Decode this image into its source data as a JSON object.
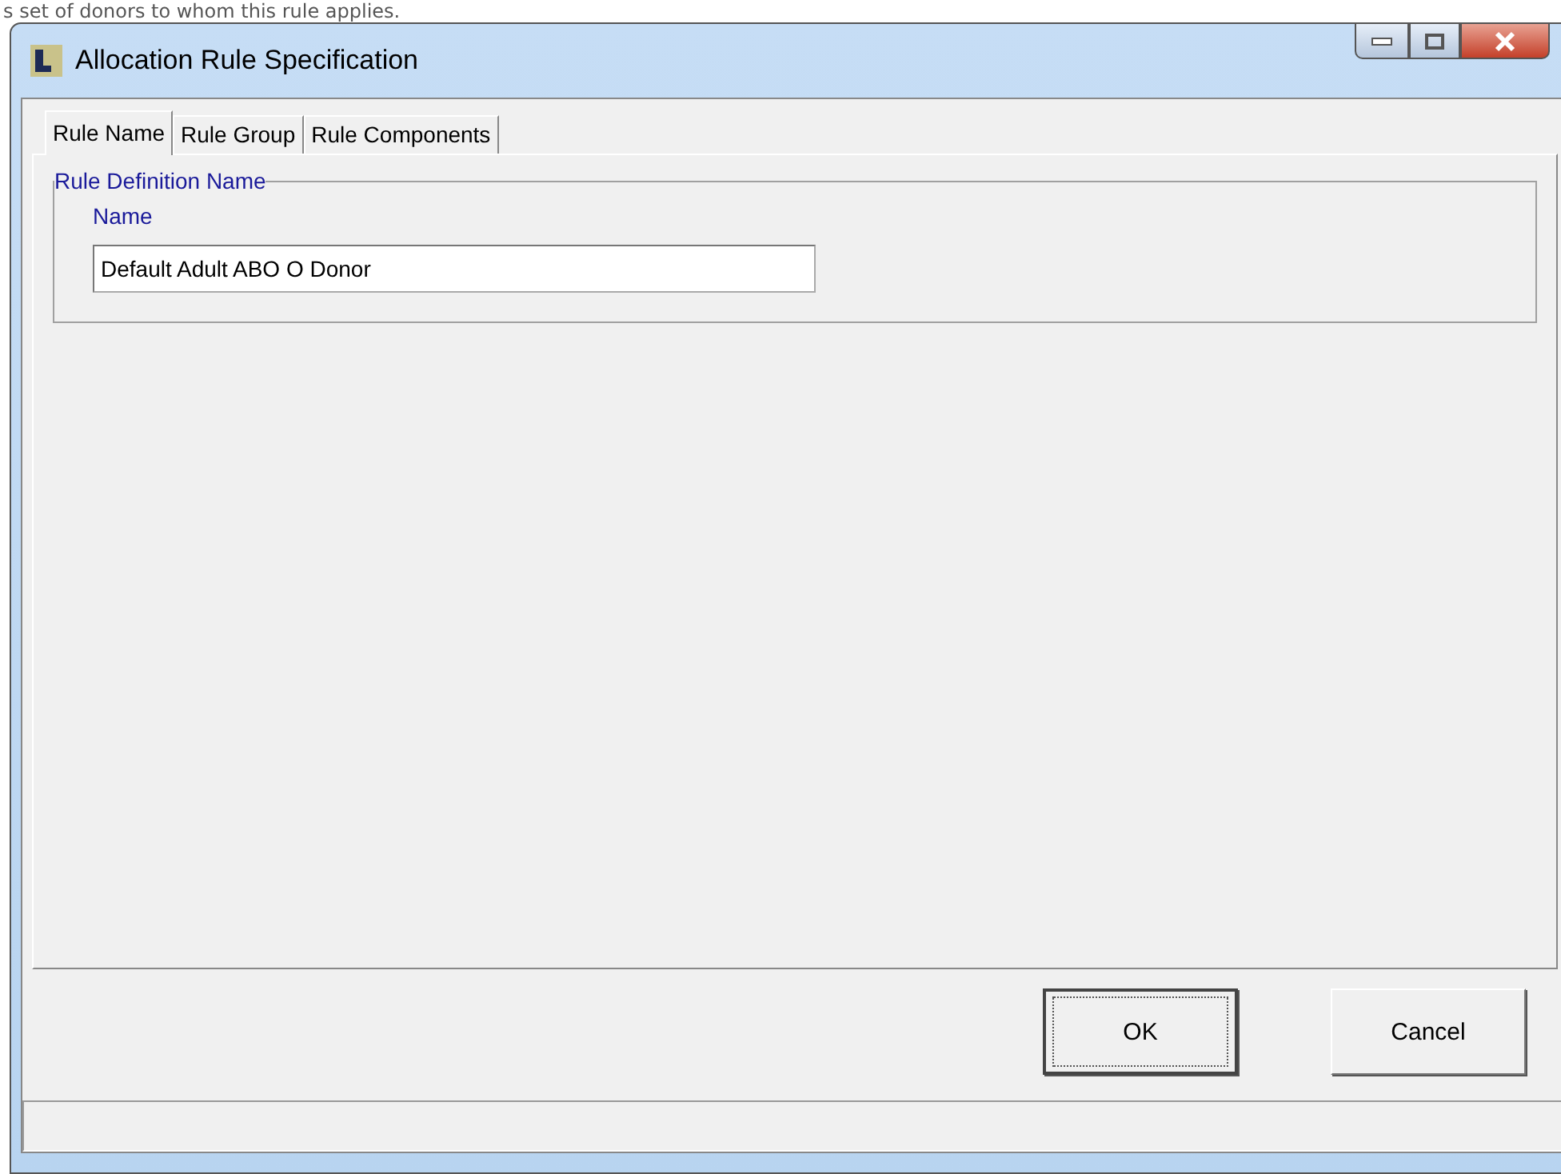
{
  "background_text": "s set of donors to whom this rule applies.",
  "window": {
    "title": "Allocation Rule Specification"
  },
  "tabs": [
    {
      "label": "Rule Name",
      "selected": true
    },
    {
      "label": "Rule Group",
      "selected": false
    },
    {
      "label": "Rule Components",
      "selected": false
    }
  ],
  "group": {
    "title": "Rule Definition Name",
    "field": {
      "label": "Name",
      "value": "Default Adult ABO O Donor"
    }
  },
  "buttons": [
    {
      "label": "OK",
      "default": true
    },
    {
      "label": "Cancel",
      "default": false
    }
  ]
}
